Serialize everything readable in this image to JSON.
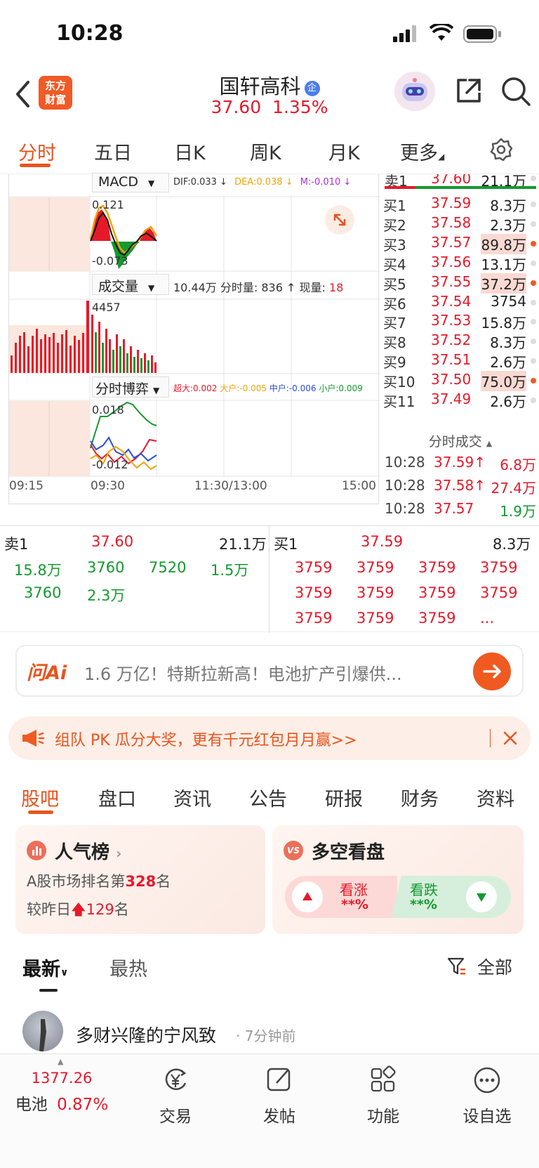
{
  "status": {
    "time": "10:28"
  },
  "header": {
    "badge": "东方\n财富",
    "badge_line1": "东方",
    "badge_line2": "财富",
    "stock_name": "国轩高科",
    "ent_badge": "企",
    "price": "37.60",
    "change": "1.35%"
  },
  "period_tabs": [
    "分时",
    "五日",
    "日K",
    "周K",
    "月K",
    "更多"
  ],
  "macd": {
    "label": "MACD",
    "dif": "DIF:0.033 ↓",
    "dea": "DEA:0.038 ↓",
    "m": "M:-0.010 ↓",
    "ymax": "0.121",
    "ymin": "-0.073"
  },
  "volume": {
    "label": "成交量",
    "summary": "10.44万 分时量: 836 ↑ 现量:",
    "current": "18",
    "ymax": "4457"
  },
  "game": {
    "label": "分时博弈",
    "super": "超大:0.002",
    "large": "大户:-0.005",
    "mid": "中户:-0.006",
    "small": "小户:0.009",
    "ymax": "0.018",
    "ymin": "-0.012"
  },
  "time_axis": [
    "09:15",
    "09:30",
    "11:30/13:00",
    "15:00"
  ],
  "order_book": {
    "sell1": {
      "label": "卖1",
      "price": "37.60",
      "vol": "21.1万"
    },
    "buys": [
      {
        "label": "买1",
        "price": "37.59",
        "vol": "8.3万"
      },
      {
        "label": "买2",
        "price": "37.58",
        "vol": "2.3万"
      },
      {
        "label": "买3",
        "price": "37.57",
        "vol": "89.8万"
      },
      {
        "label": "买4",
        "price": "37.56",
        "vol": "13.1万"
      },
      {
        "label": "买5",
        "price": "37.55",
        "vol": "37.2万"
      },
      {
        "label": "买6",
        "price": "37.54",
        "vol": "3754"
      },
      {
        "label": "买7",
        "price": "37.53",
        "vol": "15.8万"
      },
      {
        "label": "买8",
        "price": "37.52",
        "vol": "8.3万"
      },
      {
        "label": "买9",
        "price": "37.51",
        "vol": "2.6万"
      },
      {
        "label": "买10",
        "price": "37.50",
        "vol": "75.0万"
      },
      {
        "label": "买11",
        "price": "37.49",
        "vol": "2.6万"
      }
    ]
  },
  "ticks": {
    "title": "分时成交",
    "rows": [
      {
        "time": "10:28",
        "price": "37.59↑",
        "vol": "6.8万"
      },
      {
        "time": "10:28",
        "price": "37.58↑",
        "vol": "27.4万"
      },
      {
        "time": "10:28",
        "price": "37.57",
        "vol": "1.9万"
      }
    ]
  },
  "queue": {
    "sell": {
      "label": "卖1",
      "price": "37.60",
      "vol": "21.1万",
      "row1": [
        "15.8万",
        "3760",
        "7520",
        "1.5万"
      ],
      "row2": [
        "3760",
        "2.3万"
      ]
    },
    "buy": {
      "label": "买1",
      "price": "37.59",
      "vol": "8.3万",
      "row1": [
        "3759",
        "3759",
        "3759",
        "3759"
      ],
      "row2": [
        "3759",
        "3759",
        "3759",
        "3759"
      ],
      "row3": [
        "3759",
        "3759",
        "3759",
        "..."
      ]
    }
  },
  "search": {
    "logo": "问Ai",
    "text": "1.6 万亿！特斯拉新高！电池扩产引爆供..."
  },
  "banner": {
    "text": "组队 PK 瓜分大奖，更有千元红包月月赢>>"
  },
  "content_tabs": [
    "股吧",
    "盘口",
    "资讯",
    "公告",
    "研报",
    "财务",
    "资料"
  ],
  "rank_card": {
    "title": "人气榜",
    "line1_pre": "A股市场排名第",
    "rank": "328",
    "line1_post": "名",
    "line2_pre": "较昨日",
    "delta": "129",
    "line2_post": "名"
  },
  "vs_card": {
    "title": "多空看盘",
    "up_label": "看涨",
    "up_val": "**%",
    "down_label": "看跌",
    "down_val": "**%"
  },
  "feed": {
    "sort_latest": "最新",
    "sort_hot": "最热",
    "filter": "全部",
    "post_user": "多财兴隆的宁风致",
    "post_time": "· 7分钟前"
  },
  "bottom_nav": {
    "index_value": "1377.26",
    "index_name": "电池",
    "index_change": "0.87%",
    "trade": "交易",
    "post": "发帖",
    "func": "功能",
    "watch": "设自选"
  },
  "colors": {
    "accent": "#e8541e",
    "up": "#e6192b",
    "down": "#139a2e"
  }
}
